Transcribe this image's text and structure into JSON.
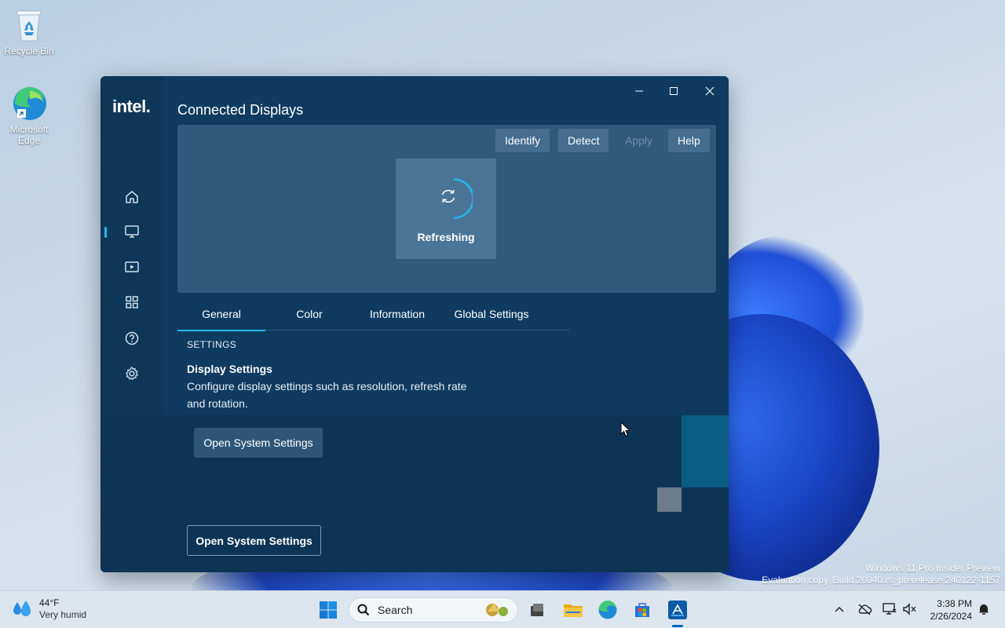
{
  "desktop": {
    "icons": [
      {
        "label": "Recycle Bin"
      },
      {
        "label": "Microsoft Edge"
      }
    ],
    "watermark": {
      "line1": "Windows 11 Pro Insider Preview",
      "line2": "Evaluation copy. Build 26040.rs_prerelease.240122-1157"
    }
  },
  "app": {
    "brand": "intel.",
    "title": "Connected Displays",
    "toolbar": {
      "identify": "Identify",
      "detect": "Detect",
      "apply": "Apply",
      "help": "Help"
    },
    "status": "Refreshing",
    "tabs": [
      "General",
      "Color",
      "Information",
      "Global Settings"
    ],
    "active_tab": "General",
    "section_label": "SETTINGS",
    "setting": {
      "title": "Display Settings",
      "description": "Configure display settings such as resolution, refresh rate and rotation."
    },
    "open_settings_primary": "Open System Settings",
    "open_settings_secondary": "Open System Settings",
    "nav_icons": [
      "home-icon",
      "monitor-icon",
      "media-icon",
      "apps-grid-icon",
      "help-icon",
      "gear-icon"
    ],
    "accent": "#25b6ea"
  },
  "taskbar": {
    "weather": {
      "temp": "44°F",
      "condition": "Very humid"
    },
    "search_placeholder": "Search",
    "clock": {
      "time": "3:38 PM",
      "date": "2/26/2024"
    }
  }
}
